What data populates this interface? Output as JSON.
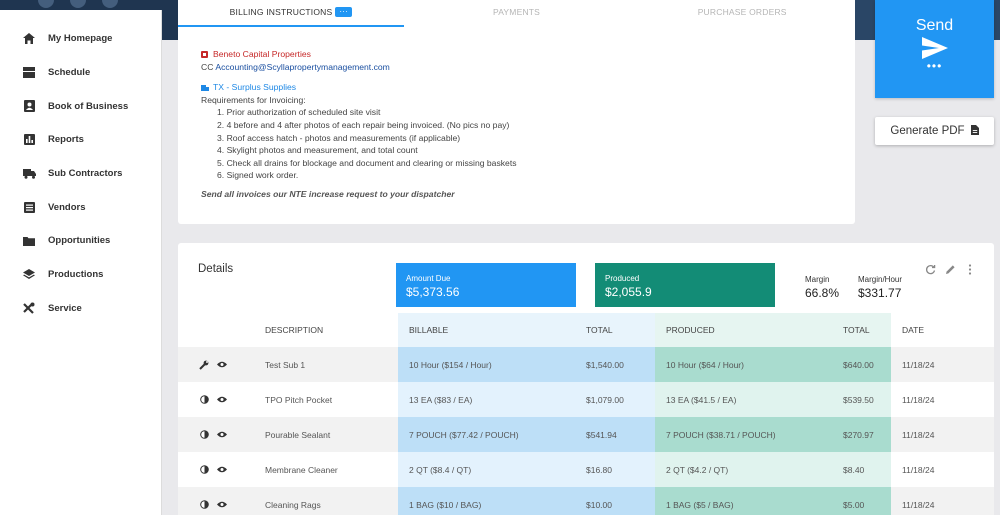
{
  "sidebar": {
    "items": [
      {
        "label": "My Homepage",
        "icon": "home-icon"
      },
      {
        "label": "Schedule",
        "icon": "schedule-icon"
      },
      {
        "label": "Book of Business",
        "icon": "contact-book-icon"
      },
      {
        "label": "Reports",
        "icon": "bar-chart-icon"
      },
      {
        "label": "Sub Contractors",
        "icon": "truck-icon"
      },
      {
        "label": "Vendors",
        "icon": "list-icon"
      },
      {
        "label": "Opportunities",
        "icon": "folder-icon"
      },
      {
        "label": "Productions",
        "icon": "layers-icon"
      },
      {
        "label": "Service",
        "icon": "tools-icon"
      }
    ]
  },
  "tabs": [
    {
      "label": "BILLING INSTRUCTIONS",
      "badge": "···",
      "active": true
    },
    {
      "label": "PAYMENTS",
      "active": false
    },
    {
      "label": "PURCHASE ORDERS",
      "active": false
    }
  ],
  "billing": {
    "company": "Beneto Capital Properties",
    "cc_prefix": "CC",
    "cc_email": "Accounting@Scyllapropertymanagement.com",
    "supplier": "TX - Surplus Supplies",
    "requirements_title": "Requirements for Invoicing:",
    "requirements": [
      "Prior authorization of scheduled site visit",
      "4 before and 4 after photos of each repair being invoiced. (No pics no pay)",
      "Roof access hatch - photos and measurements (if applicable)",
      "Skylight photos and measurement, and total count",
      "Check all drains for blockage and document and clearing or missing baskets",
      "Signed work order."
    ],
    "note": "Send all invoices our NTE increase request to your dispatcher"
  },
  "actions": {
    "send_label": "Send",
    "send_more": "•••",
    "generate_pdf_label": "Generate PDF"
  },
  "details": {
    "title": "Details",
    "amount_due_label": "Amount Due",
    "amount_due_value": "$5,373.56",
    "produced_label": "Produced",
    "produced_value": "$2,055.9",
    "margin_label": "Margin",
    "margin_value": "66.8%",
    "margin_hour_label": "Margin/Hour",
    "margin_hour_value": "$331.77",
    "columns": [
      "DESCRIPTION",
      "BILLABLE",
      "TOTAL",
      "PRODUCED",
      "TOTAL",
      "DATE"
    ],
    "rows": [
      {
        "icon": "wrench-icon",
        "description": "Test Sub 1",
        "billable": "10 Hour ($154 / Hour)",
        "billable_total": "$1,540.00",
        "produced": "10 Hour ($64 / Hour)",
        "produced_total": "$640.00",
        "date": "11/18/24"
      },
      {
        "icon": "contrast-icon",
        "description": "TPO Pitch Pocket",
        "billable": "13 EA ($83 / EA)",
        "billable_total": "$1,079.00",
        "produced": "13 EA ($41.5 / EA)",
        "produced_total": "$539.50",
        "date": "11/18/24"
      },
      {
        "icon": "contrast-icon",
        "description": "Pourable Sealant",
        "billable": "7 POUCH ($77.42 / POUCH)",
        "billable_total": "$541.94",
        "produced": "7 POUCH ($38.71 / POUCH)",
        "produced_total": "$270.97",
        "date": "11/18/24"
      },
      {
        "icon": "contrast-icon",
        "description": "Membrane Cleaner",
        "billable": "2 QT ($8.4 / QT)",
        "billable_total": "$16.80",
        "produced": "2 QT ($4.2 / QT)",
        "produced_total": "$8.40",
        "date": "11/18/24"
      },
      {
        "icon": "contrast-icon",
        "description": "Cleaning Rags",
        "billable": "1 BAG ($10 / BAG)",
        "billable_total": "$10.00",
        "produced": "1 BAG ($5 / BAG)",
        "produced_total": "$5.00",
        "date": "11/18/24"
      }
    ]
  },
  "colors": {
    "primary": "#2196f3",
    "produced": "#138c76",
    "header": "#1f3550",
    "alert": "#c62828"
  }
}
